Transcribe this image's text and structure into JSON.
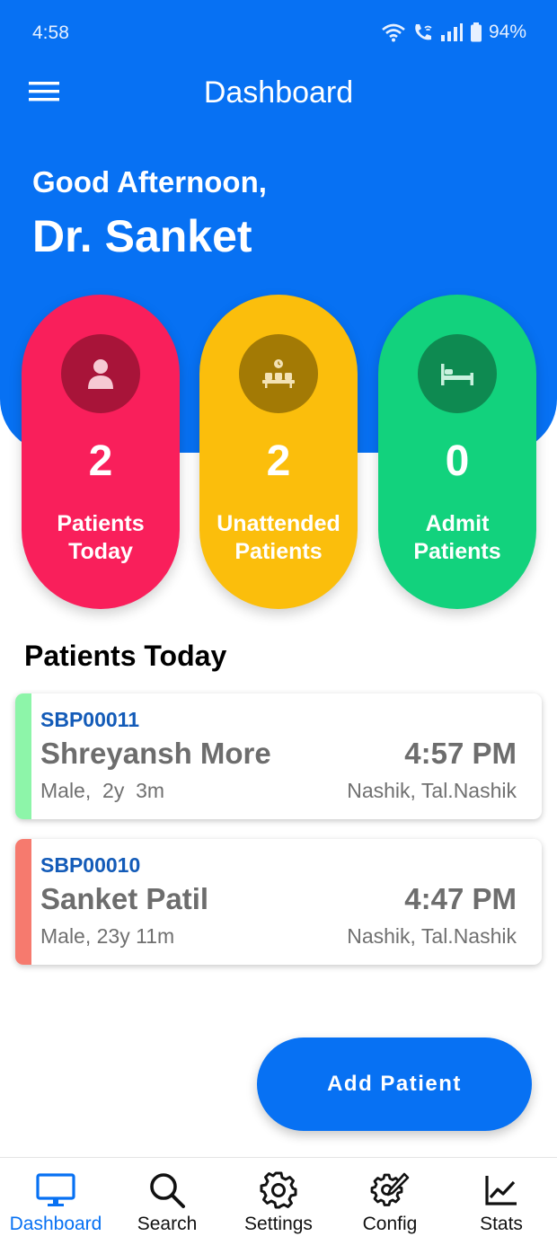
{
  "status_bar": {
    "time": "4:58",
    "battery": "94%"
  },
  "header": {
    "title": "Dashboard",
    "menu_icon": "menu-icon"
  },
  "greeting": {
    "line1": "Good Afternoon,",
    "doctor": "Dr. Sanket"
  },
  "stats": [
    {
      "count": "2",
      "label": "Patients\nToday",
      "icon": "person-icon",
      "color": "#f91f5b"
    },
    {
      "count": "2",
      "label": "Unattended\nPatients",
      "icon": "waiting-room-icon",
      "color": "#fbbe0c"
    },
    {
      "count": "0",
      "label": "Admit\nPatients",
      "icon": "bed-icon",
      "color": "#12d27d"
    }
  ],
  "patients_section": {
    "title": "Patients Today"
  },
  "patients": [
    {
      "id": "SBP00011",
      "name": "Shreyansh More",
      "time": "4:57 PM",
      "meta": "Male,  2y  3m",
      "location": "Nashik, Tal.Nashik",
      "stripe_color": "#8df5a9"
    },
    {
      "id": "SBP00010",
      "name": "Sanket Patil",
      "time": "4:47 PM",
      "meta": "Male, 23y 11m",
      "location": "Nashik, Tal.Nashik",
      "stripe_color": "#f67a6e"
    }
  ],
  "add_button": {
    "label": "Add Patient"
  },
  "nav": [
    {
      "label": "Dashboard",
      "icon": "monitor-icon",
      "active": true
    },
    {
      "label": "Search",
      "icon": "search-icon",
      "active": false
    },
    {
      "label": "Settings",
      "icon": "gear-icon",
      "active": false
    },
    {
      "label": "Config",
      "icon": "config-icon",
      "active": false
    },
    {
      "label": "Stats",
      "icon": "chart-icon",
      "active": false
    }
  ],
  "colors": {
    "primary": "#0771f3",
    "patient_id": "#135bb8"
  }
}
